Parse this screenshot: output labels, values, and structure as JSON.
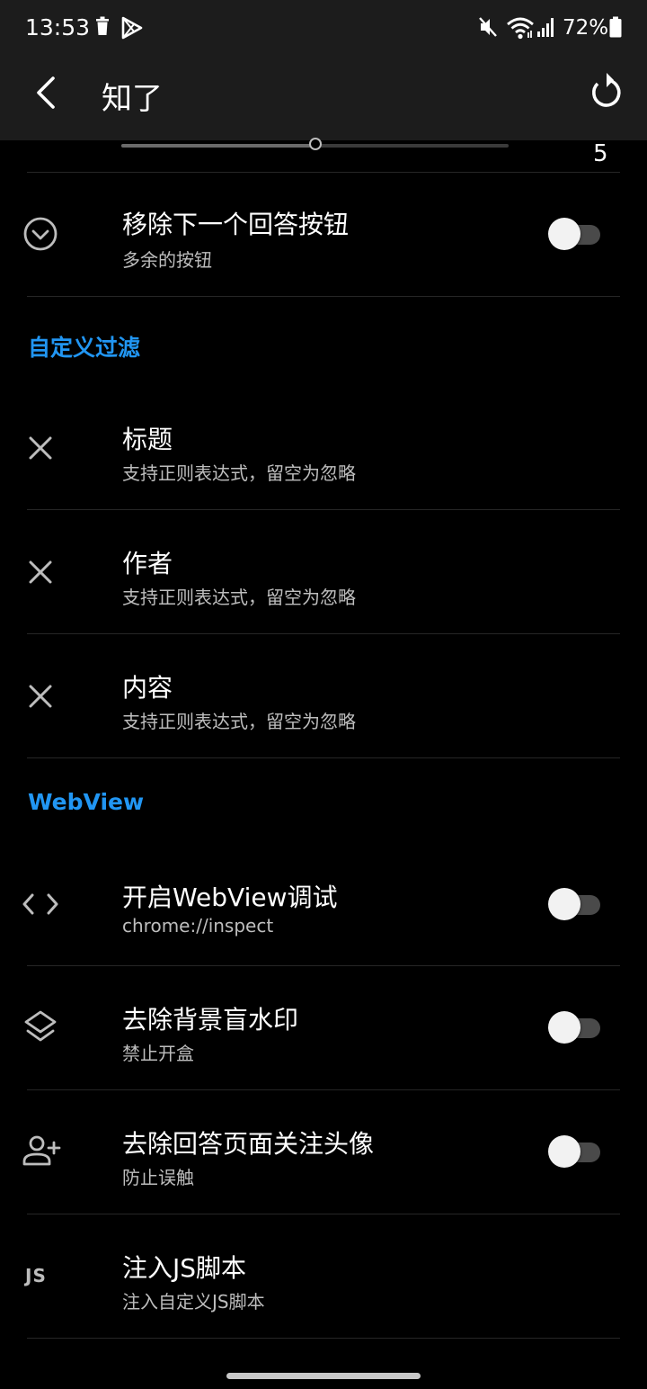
{
  "status_bar": {
    "time": "13:53",
    "battery_percent": "72%"
  },
  "app_bar": {
    "title": "知了"
  },
  "slider": {
    "value_label": "5",
    "level_fraction": 0.5
  },
  "rows": {
    "remove_next_answer": {
      "title": "移除下一个回答按钮",
      "subtitle": "多余的按钮",
      "enabled": false
    },
    "filter_title": {
      "title": "标题",
      "subtitle": "支持正则表达式，留空为忽略"
    },
    "filter_author": {
      "title": "作者",
      "subtitle": "支持正则表达式，留空为忽略"
    },
    "filter_content": {
      "title": "内容",
      "subtitle": "支持正则表达式，留空为忽略"
    },
    "webview_debug": {
      "title": "开启WebView调试",
      "subtitle": "chrome://inspect",
      "enabled": false
    },
    "remove_watermark": {
      "title": "去除背景盲水印",
      "subtitle": "禁止开盒",
      "enabled": false
    },
    "remove_follow_avatar": {
      "title": "去除回答页面关注头像",
      "subtitle": "防止误触",
      "enabled": false
    },
    "inject_js": {
      "title": "注入JS脚本",
      "subtitle": "注入自定义JS脚本",
      "icon_text": "JS"
    }
  },
  "sections": {
    "custom_filter": "自定义过滤",
    "webview": "WebView"
  },
  "colors": {
    "background": "#000000",
    "app_bar": "#1c1c1c",
    "accent": "#2196f3",
    "text_primary": "#ffffff",
    "text_secondary": "#bdbdbd"
  },
  "icons": {
    "status": [
      "trash-icon",
      "play-store-icon",
      "mute-icon",
      "wifi-icon",
      "cell-signal-icon",
      "battery-icon"
    ],
    "app_bar": [
      "back-arrow-icon",
      "refresh-icon"
    ],
    "rows": [
      "chevron-circle-down-icon",
      "close-icon",
      "close-icon",
      "close-icon",
      "code-icon",
      "layers-icon",
      "person-add-icon",
      "js-icon"
    ]
  }
}
